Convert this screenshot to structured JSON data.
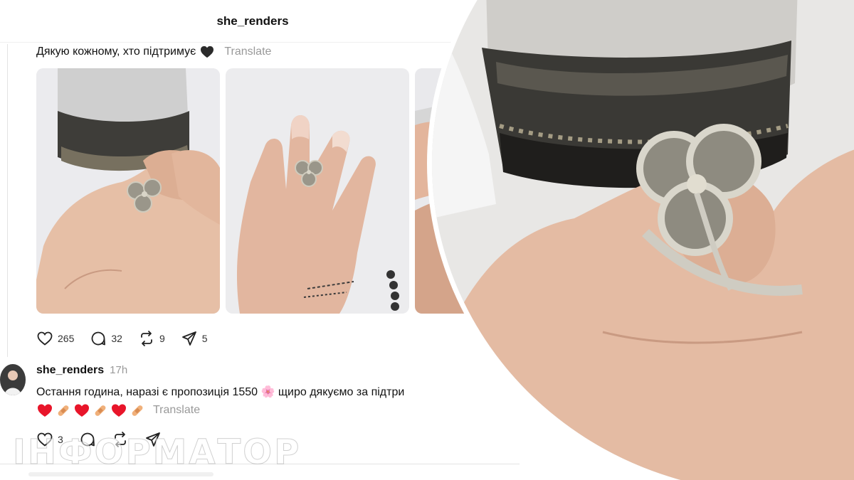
{
  "header": {
    "title": "she_renders"
  },
  "post1": {
    "text": "Дякую кожному, хто підтримує",
    "translate_label": "Translate",
    "stats": {
      "likes": "265",
      "comments": "32",
      "reposts": "9",
      "shares": "5"
    }
  },
  "post2": {
    "username": "she_renders",
    "time": "17h",
    "text": "Остання година, наразі є пропозиція 1550 🌸 щиро дякуємо за підтри",
    "translate_label": "Translate",
    "stats": {
      "likes": "3"
    }
  },
  "watermark": {
    "text": "ІНФОРМАТОР"
  },
  "icons": [
    "heart-icon",
    "comment-icon",
    "repost-icon",
    "share-icon",
    "black-heart-emoji",
    "red-heart-emoji",
    "bandage-emoji"
  ],
  "colors": {
    "secondary_text": "#999999",
    "divider": "#e3e3e3",
    "emoji_red": "#e8152a"
  }
}
